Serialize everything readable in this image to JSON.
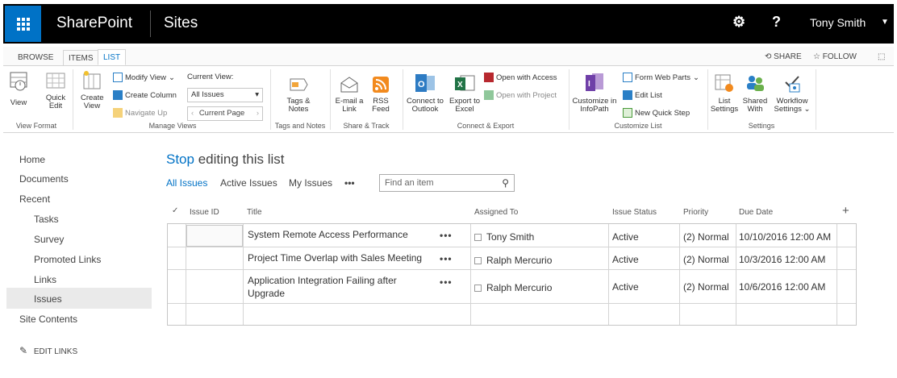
{
  "suitebar": {
    "brand": "SharePoint",
    "app": "Sites",
    "gear": "⚙",
    "help": "?",
    "user": "Tony Smith",
    "caret": "▼"
  },
  "tabs": {
    "browse": "BROWSE",
    "items": "ITEMS",
    "list": "LIST",
    "share": "SHARE",
    "follow": "FOLLOW"
  },
  "ribbon": {
    "view": "View",
    "quick_edit_1": "Quick",
    "quick_edit_2": "Edit",
    "view_format": "View Format",
    "create_view_1": "Create",
    "create_view_2": "View",
    "modify_view": "Modify View",
    "create_column": "Create Column",
    "navigate_up": "Navigate Up",
    "current_view_label": "Current View:",
    "current_view_value": "All Issues",
    "current_page": "Current Page",
    "manage_views": "Manage Views",
    "tags_1": "Tags &",
    "tags_2": "Notes",
    "tags_notes": "Tags and Notes",
    "email_1": "E-mail a",
    "email_2": "Link",
    "rss_1": "RSS",
    "rss_2": "Feed",
    "share_track": "Share & Track",
    "outlook_1": "Connect to",
    "outlook_2": "Outlook",
    "excel_1": "Export to",
    "excel_2": "Excel",
    "open_access": "Open with Access",
    "open_project": "Open with Project",
    "connect_export": "Connect & Export",
    "infopath_1": "Customize in",
    "infopath_2": "InfoPath",
    "form_web_parts": "Form Web Parts",
    "edit_list": "Edit List",
    "new_quick_step": "New Quick Step",
    "customize_list": "Customize List",
    "list_settings_1": "List",
    "list_settings_2": "Settings",
    "shared_with_1": "Shared",
    "shared_with_2": "With",
    "workflow_1": "Workflow",
    "workflow_2": "Settings",
    "settings": "Settings"
  },
  "nav": {
    "home": "Home",
    "documents": "Documents",
    "recent": "Recent",
    "tasks": "Tasks",
    "survey": "Survey",
    "promoted_links": "Promoted Links",
    "links": "Links",
    "issues": "Issues",
    "site_contents": "Site Contents",
    "edit_links": "EDIT LINKS"
  },
  "main": {
    "stop": "Stop",
    "editing": " editing this list",
    "views": [
      "All Issues",
      "Active Issues",
      "My Issues",
      "•••"
    ],
    "search_placeholder": "Find an item",
    "columns": [
      "Issue ID",
      "Title",
      "Assigned To",
      "Issue Status",
      "Priority",
      "Due Date"
    ],
    "add_col": "+",
    "rows": [
      {
        "title": "System Remote Access Performance",
        "assigned": "Tony Smith",
        "status": "Active",
        "priority": "(2) Normal",
        "due": "10/10/2016 12:00 AM"
      },
      {
        "title": "Project Time Overlap with Sales Meeting",
        "assigned": "Ralph Mercurio",
        "status": "Active",
        "priority": "(2) Normal",
        "due": "10/3/2016 12:00 AM"
      },
      {
        "title_1": "Application Integration Failing after",
        "title_2": "Upgrade",
        "assigned": "Ralph Mercurio",
        "status": "Active",
        "priority": "(2) Normal",
        "due": "10/6/2016 12:00 AM"
      }
    ],
    "row_menu": "•••"
  },
  "colors": {
    "accent": "#0072c6",
    "suitebar": "#000000"
  }
}
